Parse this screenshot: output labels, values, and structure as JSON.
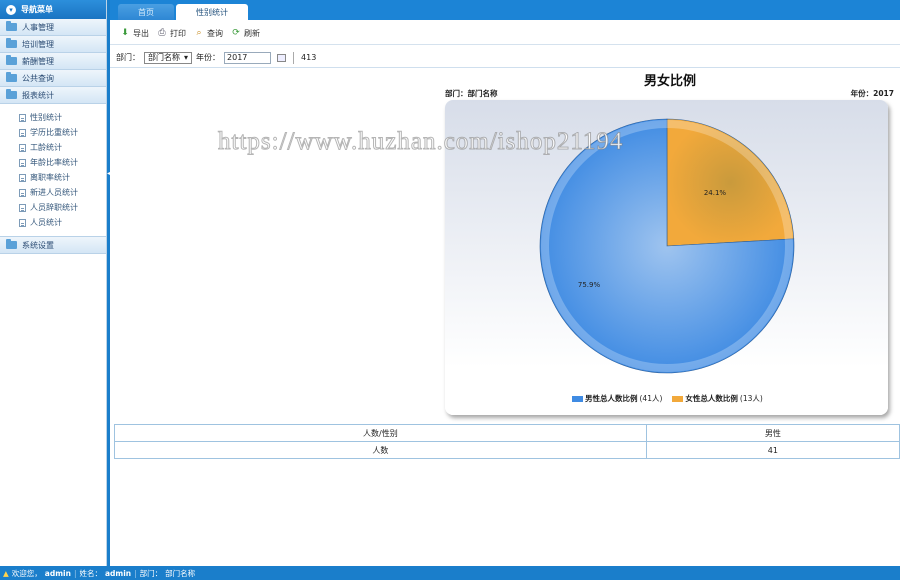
{
  "sidebar": {
    "header": "导航菜单",
    "groups": [
      {
        "label": "人事管理"
      },
      {
        "label": "培训管理"
      },
      {
        "label": "薪酬管理"
      },
      {
        "label": "公共查询"
      },
      {
        "label": "报表统计"
      }
    ],
    "report_items": [
      {
        "label": "性别统计"
      },
      {
        "label": "学历比重统计"
      },
      {
        "label": "工龄统计"
      },
      {
        "label": "年龄比率统计"
      },
      {
        "label": "离职率统计"
      },
      {
        "label": "新进人员统计"
      },
      {
        "label": "人员辞职统计"
      },
      {
        "label": "人员统计"
      }
    ],
    "last_group": "系统设置"
  },
  "tabs": [
    {
      "label": "首页",
      "active": false
    },
    {
      "label": "性别统计",
      "active": true
    }
  ],
  "toolbar": {
    "export_label": "导出",
    "print_label": "打印",
    "query_label": "查询",
    "refresh_label": "刷新"
  },
  "filter": {
    "dept_label": "部门：",
    "dept_value": "部门名称",
    "year_label": "年份：",
    "year_value": "2017",
    "count": "413"
  },
  "chart_header": {
    "title": "男女比例",
    "dept_text": "部门：部门名称",
    "year_text": "年份：2017"
  },
  "watermark": "https://www.huzhan.com/ishop21194",
  "colors": {
    "male": "#3f8be3",
    "female": "#f2a93b",
    "accent": "#1a7ecb"
  },
  "chart_data": {
    "type": "pie",
    "title": "男女比例",
    "slices": [
      {
        "name": "男性总人数比例",
        "count_label": "(41人)",
        "value": 75.9,
        "label": "75.9%"
      },
      {
        "name": "女性总人数比例",
        "count_label": "(13人)",
        "value": 24.1,
        "label": "24.1%"
      }
    ],
    "legend_position": "bottom"
  },
  "table": {
    "headers": [
      "人数/性别",
      "男性"
    ],
    "rows": [
      [
        "人数",
        "41"
      ]
    ]
  },
  "status": {
    "welcome": "欢迎您，",
    "user": "admin",
    "name_label": "姓名：",
    "name_value": "admin",
    "dept_label": "部门：",
    "dept_value": "部门名称"
  }
}
